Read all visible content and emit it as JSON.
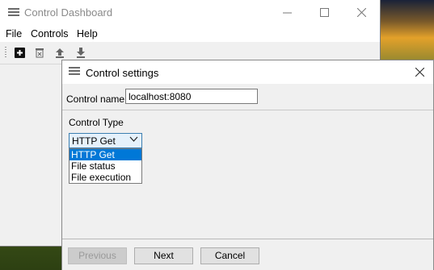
{
  "main_window": {
    "title": "Control Dashboard",
    "menu": [
      "File",
      "Controls",
      "Help"
    ],
    "toolbar_icons": [
      "add-icon",
      "delete-icon",
      "upload-icon",
      "download-icon"
    ]
  },
  "dialog": {
    "title": "Control settings",
    "control_name_label": "Control name:",
    "control_name_value": "localhost:8080",
    "control_type_label": "Control Type",
    "control_type_selected": "HTTP Get",
    "control_type_options": [
      "HTTP Get",
      "File status",
      "File execution"
    ],
    "buttons": {
      "previous": "Previous",
      "next": "Next",
      "cancel": "Cancel"
    }
  },
  "colors": {
    "selection": "#0078d7",
    "combo_focus": "#e5f1fb"
  }
}
